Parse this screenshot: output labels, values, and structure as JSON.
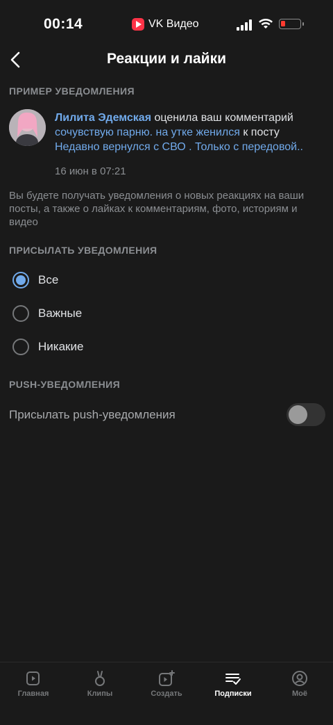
{
  "status_bar": {
    "time": "00:14",
    "app_name": "VK Видео"
  },
  "header": {
    "title": "Реакции и лайки"
  },
  "example": {
    "section_title": "ПРИМЕР УВЕДОМЛЕНИЯ",
    "user_name": "Лилита Эдемская",
    "text_rated": " оценила ваш комментарий ",
    "comment_link": "сочувствую парню. на утке женился",
    "text_to_post": " к посту ",
    "post_link": "Недавно вернулся с СВО . Только с передовой..",
    "date": "16 июн в 07:21"
  },
  "info_text": "Вы будете получать уведомления о новых реакциях на ваши посты, а также о лайках к комментариям, фото, историям и видео",
  "send_section": {
    "title": "ПРИСЫЛАТЬ УВЕДОМЛЕНИЯ",
    "options": [
      {
        "label": "Все",
        "checked": true
      },
      {
        "label": "Важные",
        "checked": false
      },
      {
        "label": "Никакие",
        "checked": false
      }
    ]
  },
  "push_section": {
    "title": "PUSH-УВЕДОМЛЕНИЯ",
    "toggle_label": "Присылать push-уведомления",
    "enabled": false
  },
  "tabbar": {
    "tabs": [
      {
        "label": "Главная",
        "icon": "home-video-icon",
        "active": false
      },
      {
        "label": "Клипы",
        "icon": "clips-icon",
        "active": false
      },
      {
        "label": "Создать",
        "icon": "create-video-icon",
        "active": false
      },
      {
        "label": "Подписки",
        "icon": "subscriptions-icon",
        "active": true
      },
      {
        "label": "Моё",
        "icon": "profile-icon",
        "active": false
      }
    ]
  },
  "colors": {
    "accent": "#71aaeb",
    "background": "#1a1a1a",
    "secondary_text": "#8b8e92"
  }
}
